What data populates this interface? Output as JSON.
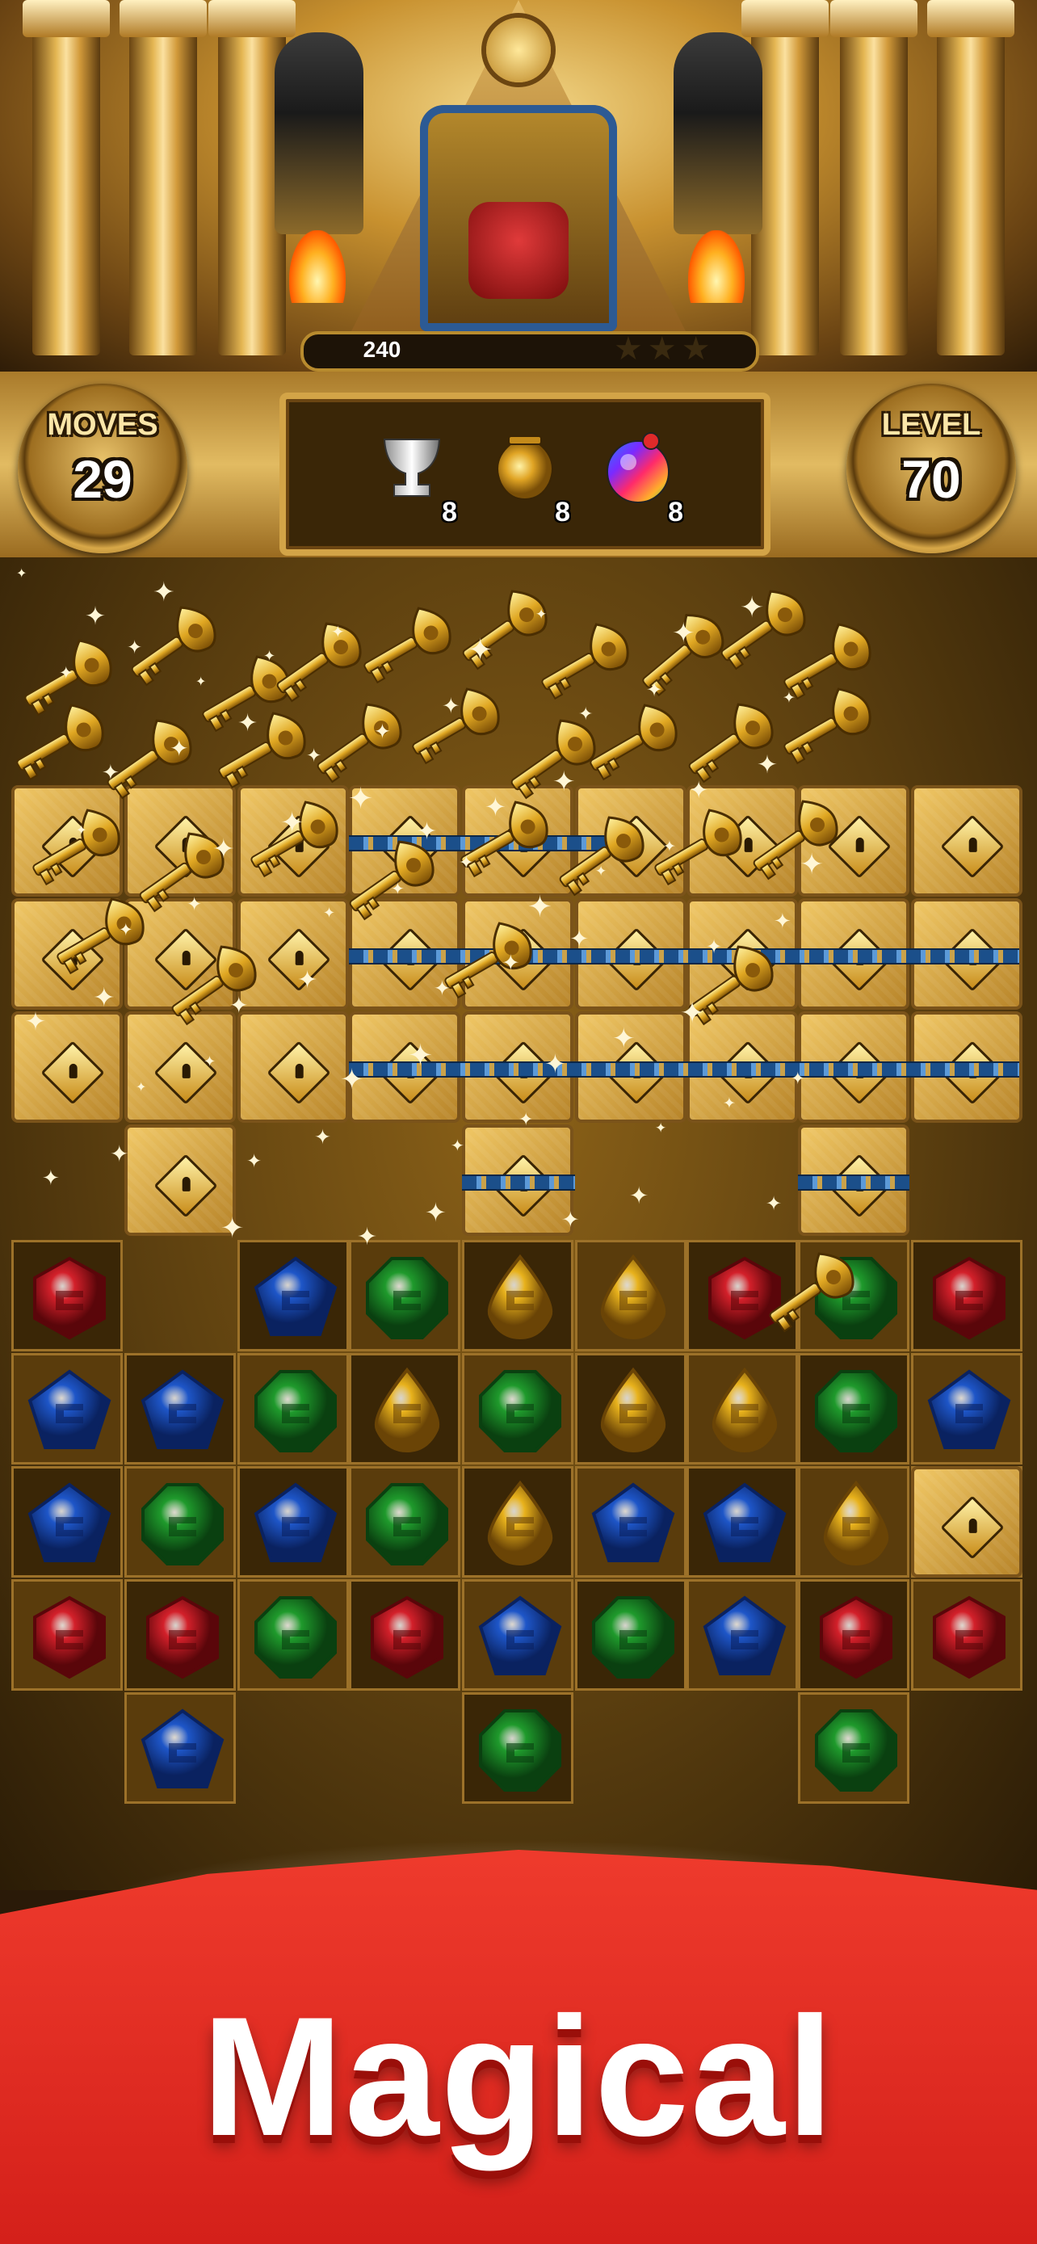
{
  "header": {
    "score": "240",
    "stars_earned": 0,
    "stars_total": 3
  },
  "hud": {
    "moves_label": "MOVES",
    "moves_value": "29",
    "level_label": "LEVEL",
    "level_value": "70",
    "goals": [
      {
        "icon": "silver-chalice-icon",
        "count": "8"
      },
      {
        "icon": "golden-urn-icon",
        "count": "8"
      },
      {
        "icon": "rainbow-orb-icon",
        "count": "8"
      }
    ]
  },
  "board": {
    "gem_rows": [
      [
        "red",
        null,
        "blue",
        "green",
        "yellow",
        "yellow",
        "red",
        "green",
        "red"
      ],
      [
        "blue",
        "blue",
        "green",
        "yellow",
        "green",
        "yellow",
        "yellow",
        "green",
        "blue"
      ],
      [
        "blue",
        "green",
        "blue",
        "green",
        "yellow",
        "blue",
        "blue",
        "yellow",
        "locked"
      ],
      [
        "red",
        "red",
        "green",
        "red",
        "blue",
        "green",
        "blue",
        "red",
        "red"
      ],
      [
        null,
        "blue",
        null,
        null,
        "green",
        null,
        null,
        "green",
        null
      ]
    ]
  },
  "colors": {
    "red_gem": "#d3202a",
    "blue_gem": "#1e56c8",
    "green_gem": "#1f9a2c",
    "yellow_gem": "#e8b21c",
    "banner": "#e22a20"
  },
  "banner": {
    "text": "Magical"
  }
}
